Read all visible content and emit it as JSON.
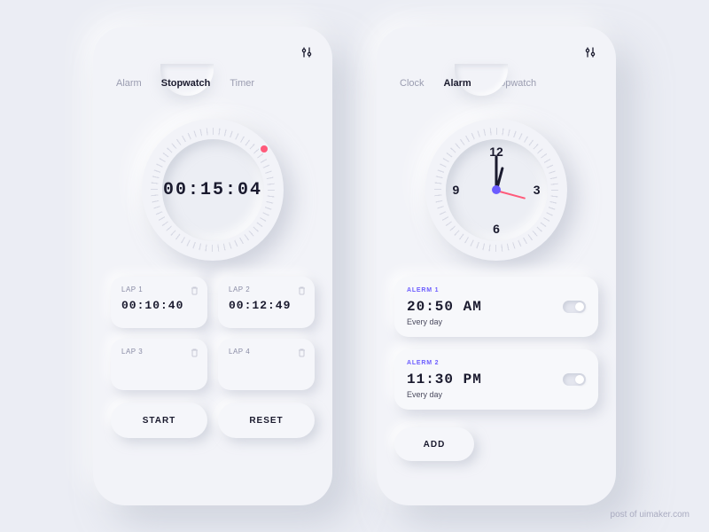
{
  "left": {
    "tabs": [
      "Alarm",
      "Stopwatch",
      "Timer"
    ],
    "active_tab": "Stopwatch",
    "digital_time": "00:15:04",
    "laps": [
      {
        "label": "LAP 1",
        "time": "00:10:40"
      },
      {
        "label": "LAP 2",
        "time": "00:12:49"
      },
      {
        "label": "LAP 3",
        "time": ""
      },
      {
        "label": "LAP 4",
        "time": ""
      }
    ],
    "start_label": "START",
    "reset_label": "RESET"
  },
  "right": {
    "tabs": [
      "Clock",
      "Alarm",
      "Stopwatch"
    ],
    "active_tab": "Alarm",
    "clock_numbers": {
      "n12": "12",
      "n3": "3",
      "n6": "6",
      "n9": "9"
    },
    "alarms": [
      {
        "label": "ALERM 1",
        "time": "20:50 AM",
        "repeat": "Every day"
      },
      {
        "label": "ALERM 2",
        "time": "11:30 PM",
        "repeat": "Every day"
      }
    ],
    "add_label": "ADD"
  },
  "credit": "post of uimaker.com"
}
